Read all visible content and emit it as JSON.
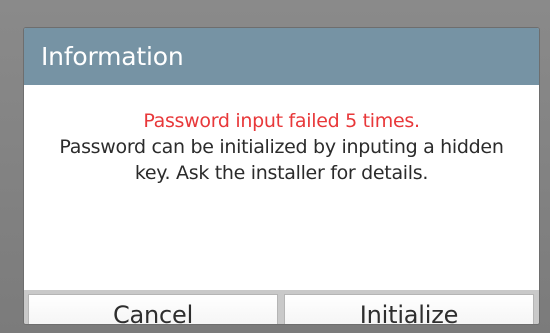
{
  "dialog": {
    "title": "Information",
    "message": {
      "error_line": "Password input failed 5 times.",
      "line2": "Password can be initialized by inputing a hidden",
      "line3": "key. Ask the installer for details."
    },
    "buttons": {
      "cancel_label": "Cancel",
      "initialize_label": "Initialize"
    }
  },
  "colors": {
    "title_bar": "#7693a4",
    "error_text": "#e8383a",
    "body_text": "#2b2b2b"
  }
}
